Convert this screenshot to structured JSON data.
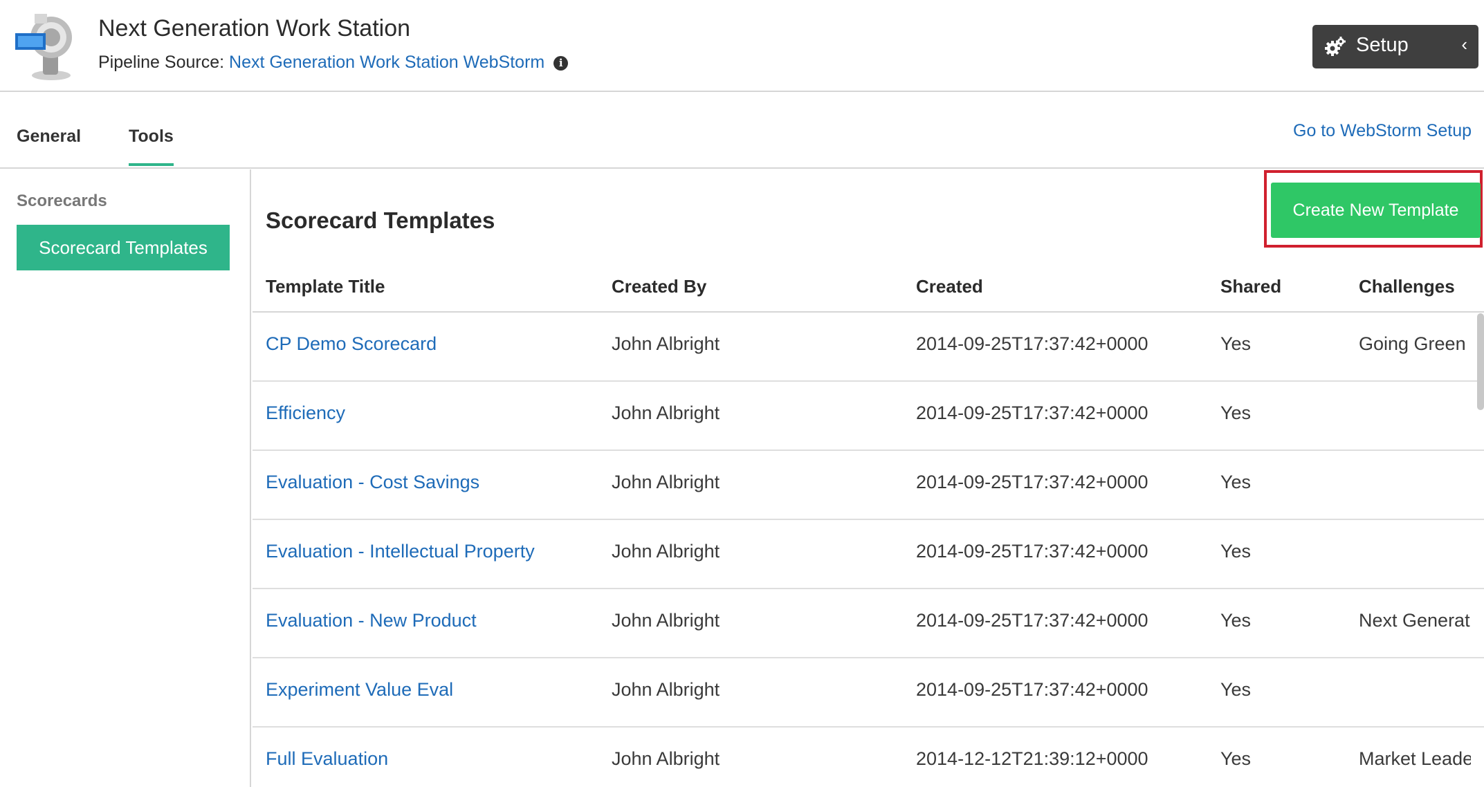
{
  "header": {
    "app_title": "Next Generation Work Station",
    "source_label": "Pipeline Source:",
    "source_link": "Next Generation Work Station WebStorm",
    "info_glyph": "i",
    "setup_label": "Setup",
    "setup_chevron": "‹"
  },
  "tabs": {
    "items": [
      {
        "label": "General"
      },
      {
        "label": "Tools"
      }
    ],
    "active": "Tools",
    "goto_link": "Go to WebStorm Setup"
  },
  "sidebar": {
    "heading": "Scorecards",
    "items": [
      {
        "label": "Scorecard Templates"
      }
    ]
  },
  "main": {
    "section_title": "Scorecard Templates",
    "create_button": "Create New Template",
    "columns": [
      "Template Title",
      "Created By",
      "Created",
      "Shared",
      "Challenges"
    ],
    "rows": [
      {
        "title": "CP Demo Scorecard",
        "created_by": "John Albright",
        "created": "2014-09-25T17:37:42+0000",
        "shared": "Yes",
        "challenges": "Going Green ("
      },
      {
        "title": "Efficiency",
        "created_by": "John Albright",
        "created": "2014-09-25T17:37:42+0000",
        "shared": "Yes",
        "challenges": ""
      },
      {
        "title": "Evaluation - Cost Savings",
        "created_by": "John Albright",
        "created": "2014-09-25T17:37:42+0000",
        "shared": "Yes",
        "challenges": ""
      },
      {
        "title": "Evaluation - Intellectual Property",
        "created_by": "John Albright",
        "created": "2014-09-25T17:37:42+0000",
        "shared": "Yes",
        "challenges": ""
      },
      {
        "title": "Evaluation - New Product",
        "created_by": "John Albright",
        "created": "2014-09-25T17:37:42+0000",
        "shared": "Yes",
        "challenges": "Next Generat"
      },
      {
        "title": "Experiment Value Eval",
        "created_by": "John Albright",
        "created": "2014-09-25T17:37:42+0000",
        "shared": "Yes",
        "challenges": ""
      },
      {
        "title": "Full Evaluation",
        "created_by": "John Albright",
        "created": "2014-12-12T21:39:12+0000",
        "shared": "Yes",
        "challenges": "Market Leade"
      }
    ]
  },
  "colors": {
    "accent_green": "#2fb58a",
    "button_green": "#2fc766",
    "link_blue": "#1e6bb8",
    "highlight_red": "#d0202e",
    "setup_dark": "#3f3f3f"
  },
  "icons": [
    "app-logo-icon",
    "info-icon",
    "gear-icon",
    "chevron-left-icon"
  ]
}
